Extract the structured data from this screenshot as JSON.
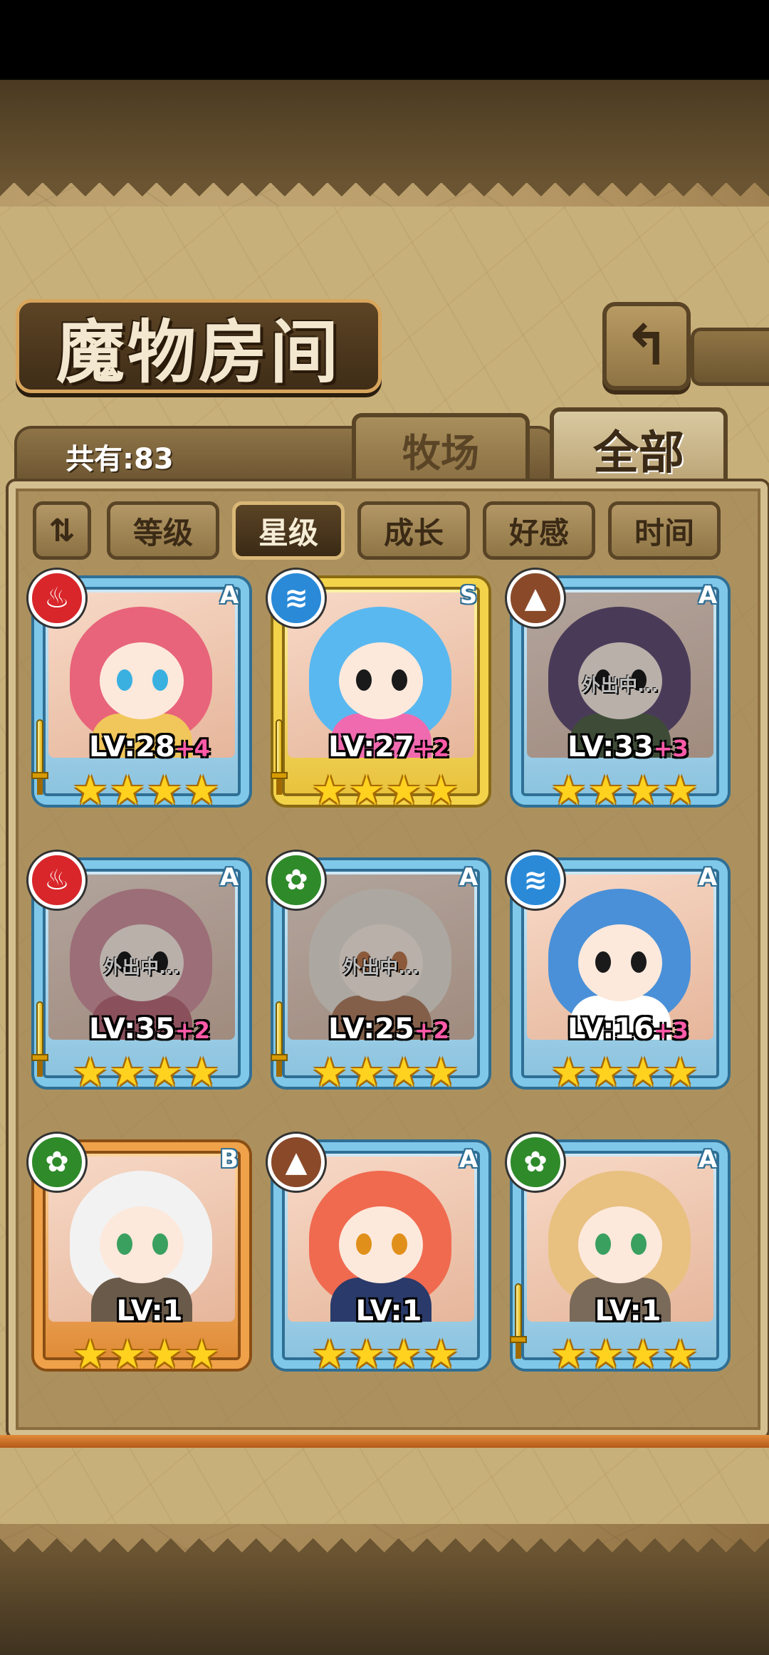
{
  "header": {
    "title": "魔物房间",
    "back_icon": "return-arrow-icon",
    "back_glyph": "↰"
  },
  "count": {
    "label": "共有:83"
  },
  "tabs": [
    {
      "label": "牧场",
      "active": false
    },
    {
      "label": "全部",
      "active": true
    }
  ],
  "sort": {
    "toggle_glyph": "⇅",
    "buttons": [
      {
        "label": "等级",
        "active": false
      },
      {
        "label": "星级",
        "active": true
      },
      {
        "label": "成长",
        "active": false
      },
      {
        "label": "好感",
        "active": false
      },
      {
        "label": "时间",
        "active": false
      }
    ]
  },
  "monsters": [
    {
      "element": "fire",
      "element_glyph": "♨",
      "rank": "A",
      "level": "LV:28",
      "plus": "+4",
      "stars": 4,
      "frame": "blue",
      "away": "",
      "hair": "#e8647a",
      "body": "#f1c65a",
      "eye": "#3ab0e0",
      "sword": true
    },
    {
      "element": "water",
      "element_glyph": "≋",
      "rank": "S",
      "level": "LV:27",
      "plus": "+2",
      "stars": 4,
      "frame": "gold",
      "away": "",
      "hair": "#5ab8f0",
      "body": "#f06ab0",
      "eye": "#1a1a1a",
      "sword": true
    },
    {
      "element": "earth",
      "element_glyph": "▲",
      "rank": "A",
      "level": "LV:33",
      "plus": "+3",
      "stars": 4,
      "frame": "blue",
      "away": "外出中...",
      "hair": "#6a4a8a",
      "body": "#4a6a3a",
      "eye": "#1a1a1a",
      "sword": false
    },
    {
      "element": "fire",
      "element_glyph": "♨",
      "rank": "A",
      "level": "LV:35",
      "plus": "+2",
      "stars": 4,
      "frame": "blue",
      "away": "外出中...",
      "hair": "#f08aa0",
      "body": "#e0607a",
      "eye": "#1a1a1a",
      "sword": true
    },
    {
      "element": "wood",
      "element_glyph": "✿",
      "rank": "A",
      "level": "LV:25",
      "plus": "+2",
      "stars": 4,
      "frame": "blue",
      "away": "外出中...",
      "hair": "#e8e0d0",
      "body": "#c87a4a",
      "eye": "#e0702a",
      "sword": true
    },
    {
      "element": "water",
      "element_glyph": "≋",
      "rank": "A",
      "level": "LV:16",
      "plus": "+3",
      "stars": 4,
      "frame": "blue",
      "away": "",
      "hair": "#4a90d8",
      "body": "#ffffff",
      "eye": "#1a1a1a",
      "sword": false
    },
    {
      "element": "wood",
      "element_glyph": "✿",
      "rank": "B",
      "level": "LV:1",
      "plus": "",
      "stars": 4,
      "frame": "bronze",
      "away": "",
      "hair": "#f2f2f2",
      "body": "#6a5a4a",
      "eye": "#3aa060",
      "sword": false
    },
    {
      "element": "earth",
      "element_glyph": "▲",
      "rank": "A",
      "level": "LV:1",
      "plus": "",
      "stars": 4,
      "frame": "blue",
      "away": "",
      "hair": "#f06a50",
      "body": "#2a3a6a",
      "eye": "#e0901a",
      "sword": false
    },
    {
      "element": "wood",
      "element_glyph": "✿",
      "rank": "A",
      "level": "LV:1",
      "plus": "",
      "stars": 4,
      "frame": "blue",
      "away": "",
      "hair": "#e8c080",
      "body": "#7a6a5a",
      "eye": "#3aa060",
      "sword": true
    }
  ],
  "colors": {
    "accent": "#d9b877",
    "parchment": "#c8b07a",
    "dark_brown": "#5a4426"
  }
}
